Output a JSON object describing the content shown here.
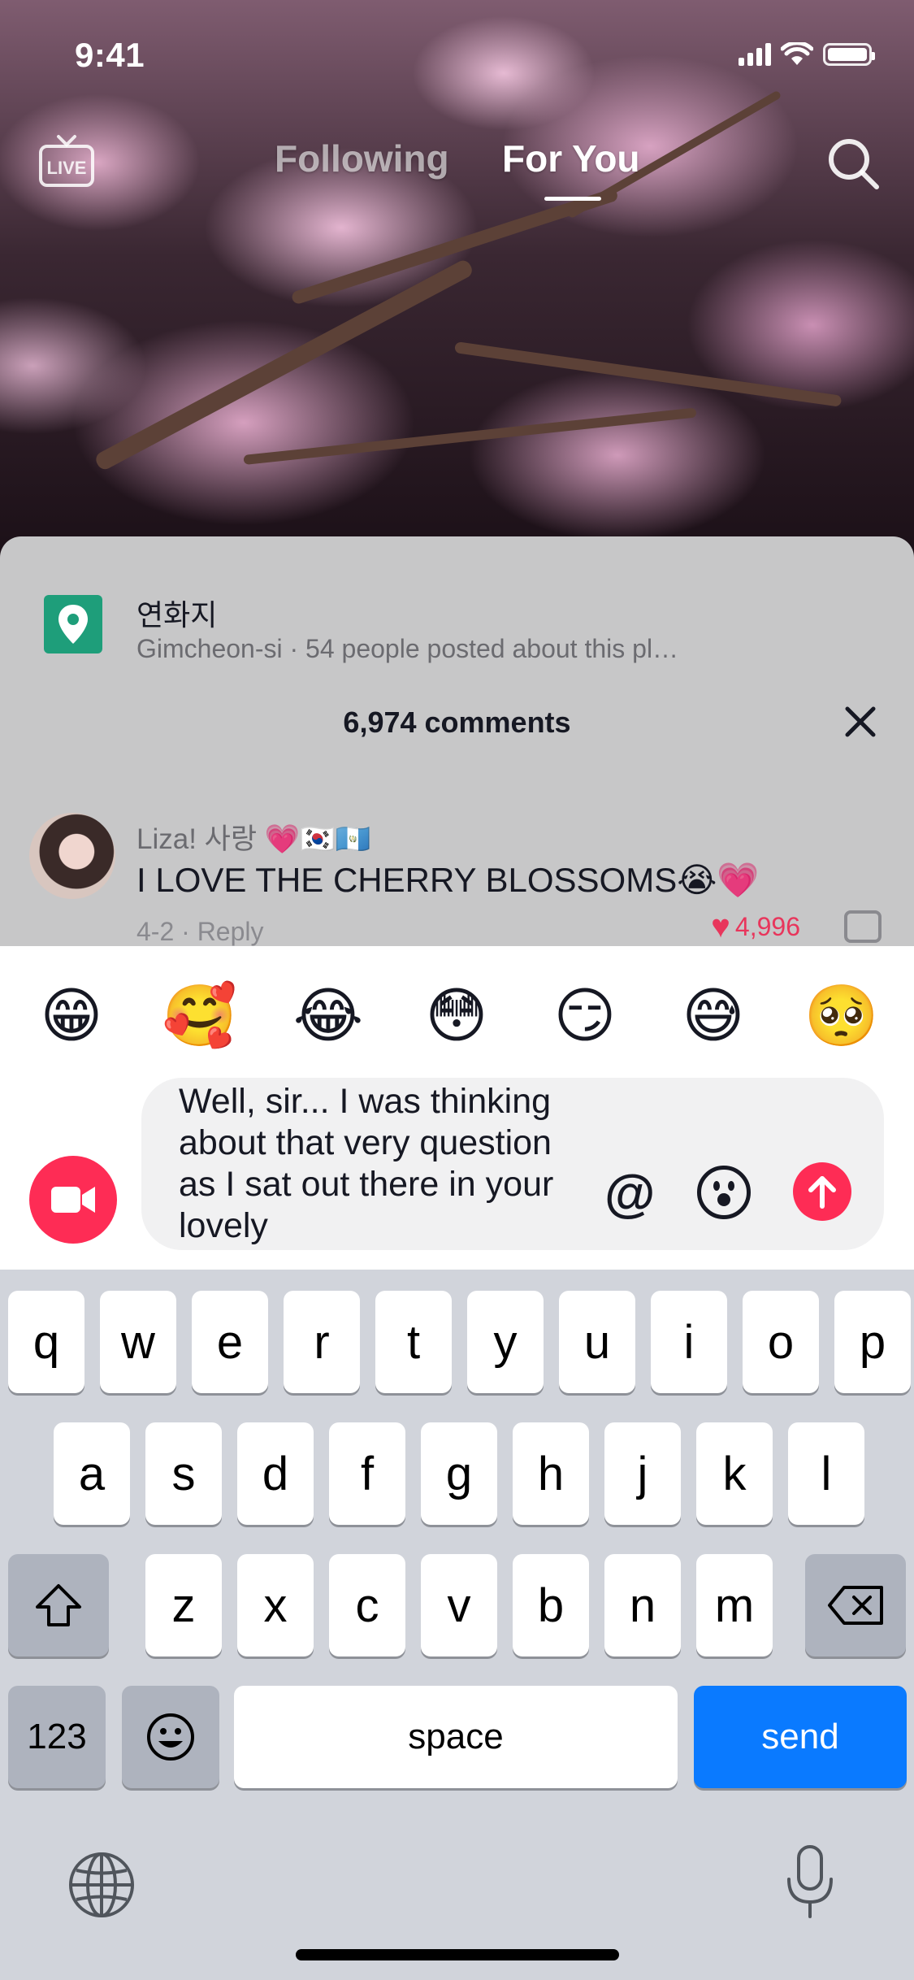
{
  "status_bar": {
    "time": "9:41"
  },
  "top_nav": {
    "live_label": "LIVE",
    "tabs": [
      {
        "label": "Following"
      },
      {
        "label": "For You"
      }
    ]
  },
  "location": {
    "name": "연화지",
    "subtitle": "Gimcheon-si · 54 people posted about this pl…"
  },
  "comments": {
    "count_label": "6,974 comments",
    "items": [
      {
        "username": "Liza! 사랑 💗🇰🇷🇬🇹",
        "text": "I LOVE THE CHERRY BLOSSOMS😭💗",
        "meta": "4-2 · Reply",
        "likes": "4,996"
      }
    ]
  },
  "composer": {
    "emoji_suggestions": [
      "😁",
      "🥰",
      "😂",
      "😳",
      "😏",
      "😅",
      "🥺"
    ],
    "input_text": "Well, sir... I was thinking about that very question as I sat out there in your lovely",
    "at_label": "@"
  },
  "keyboard": {
    "row1": [
      "q",
      "w",
      "e",
      "r",
      "t",
      "y",
      "u",
      "i",
      "o",
      "p"
    ],
    "row2": [
      "a",
      "s",
      "d",
      "f",
      "g",
      "h",
      "j",
      "k",
      "l"
    ],
    "row3": [
      "z",
      "x",
      "c",
      "v",
      "b",
      "n",
      "m"
    ],
    "numbers_label": "123",
    "space_label": "space",
    "send_label": "send"
  },
  "colors": {
    "accent": "#fe2c55",
    "keyboard_blue": "#0a7aff",
    "location_green": "#1e9e7a"
  }
}
